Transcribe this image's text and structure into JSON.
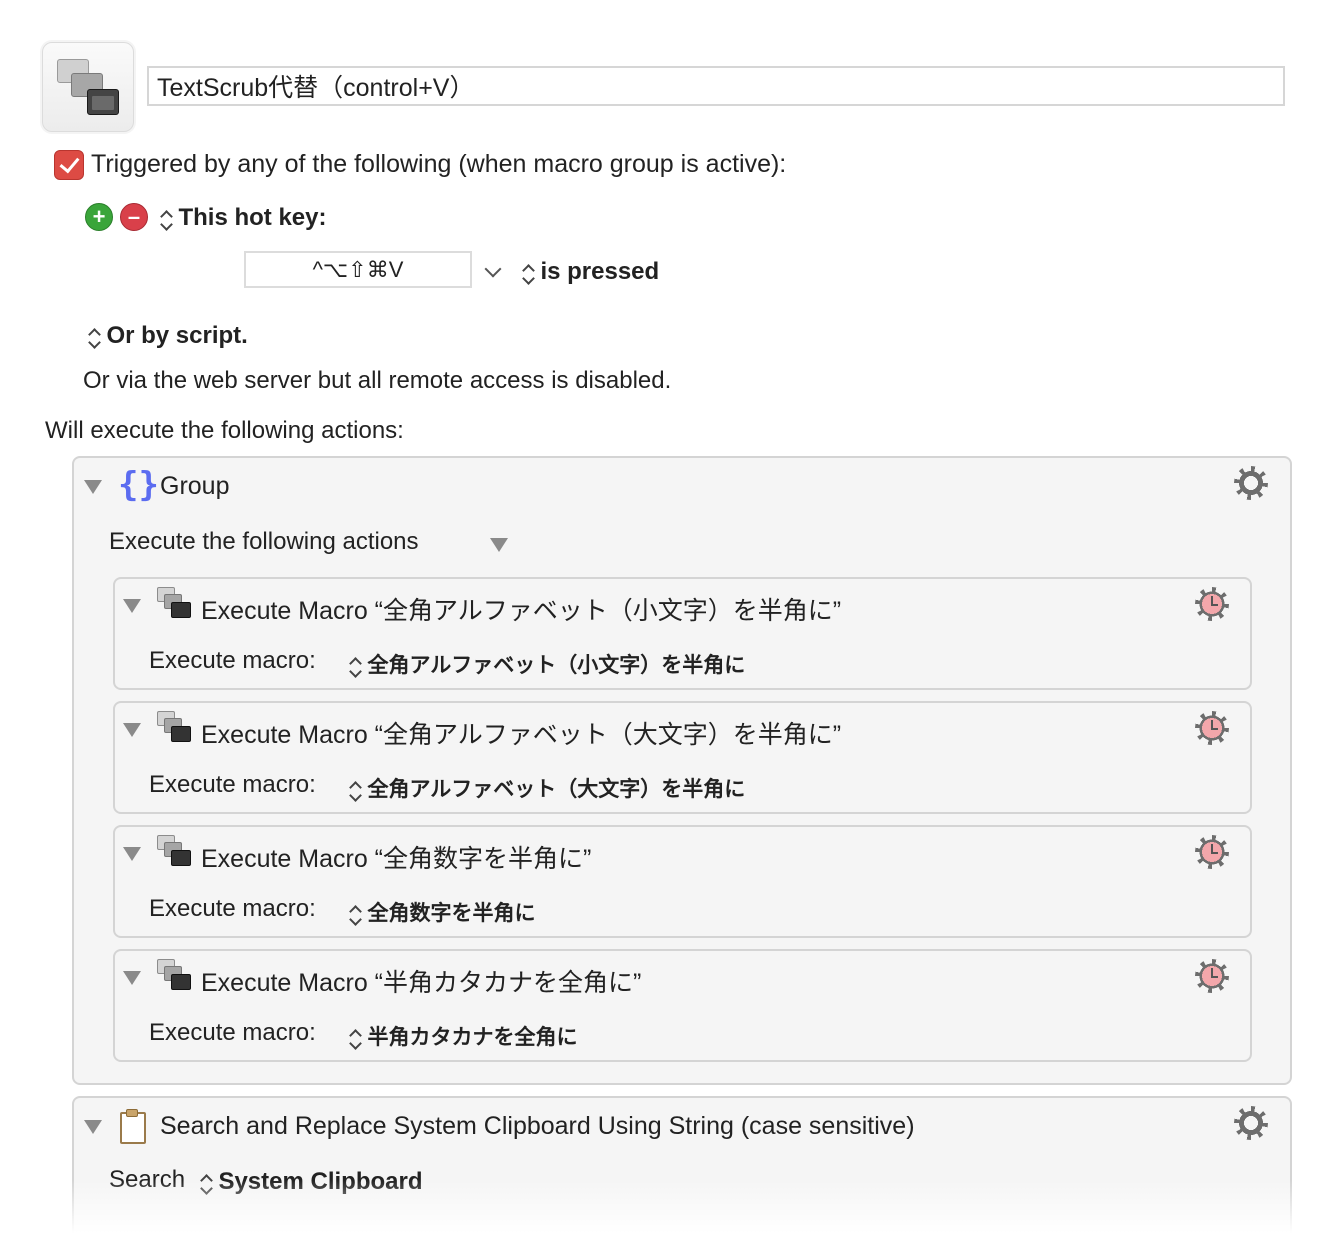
{
  "macro": {
    "name": "TextScrub代替（control+V）"
  },
  "trigger": {
    "header": "Triggered by any of the following (when macro group is active):",
    "hotkey_label": "This hot key:",
    "hotkey_value": "^⌥⇧⌘V",
    "hotkey_state": "is pressed",
    "script_label": "Or by script.",
    "web_server_text": "Or via the web server but all remote access is disabled."
  },
  "actions_header": "Will execute the following actions:",
  "group": {
    "title": "Group",
    "subtitle": "Execute the following actions",
    "items": [
      {
        "title": "Execute Macro “全角アルファベット（小文字）を半角に”",
        "label": "Execute macro:",
        "value": "全角アルファベット（小文字）を半角に"
      },
      {
        "title": "Execute Macro “全角アルファベット（大文字）を半角に”",
        "label": "Execute macro:",
        "value": "全角アルファベット（大文字）を半角に"
      },
      {
        "title": "Execute Macro “全角数字を半角に”",
        "label": "Execute macro:",
        "value": "全角数字を半角に"
      },
      {
        "title": "Execute Macro “半角カタカナを全角に”",
        "label": "Execute macro:",
        "value": "半角カタカナを全角に"
      }
    ]
  },
  "search_action": {
    "title": "Search and Replace System Clipboard Using String (case sensitive)",
    "search_label": "Search",
    "search_value": "System Clipboard"
  },
  "icons": {
    "macro": "macro-windows-icon",
    "add": "plus-circle-icon",
    "remove": "minus-circle-icon",
    "group": "braces-icon",
    "gear": "gear-icon",
    "clock_gear": "gear-clock-icon",
    "clipboard": "clipboard-icon"
  },
  "colors": {
    "checkbox": "#dd4b44",
    "add": "#3aa53a",
    "remove": "#d9404a",
    "braces": "#5b6cf0",
    "clock_face": "#f3a7ab"
  }
}
